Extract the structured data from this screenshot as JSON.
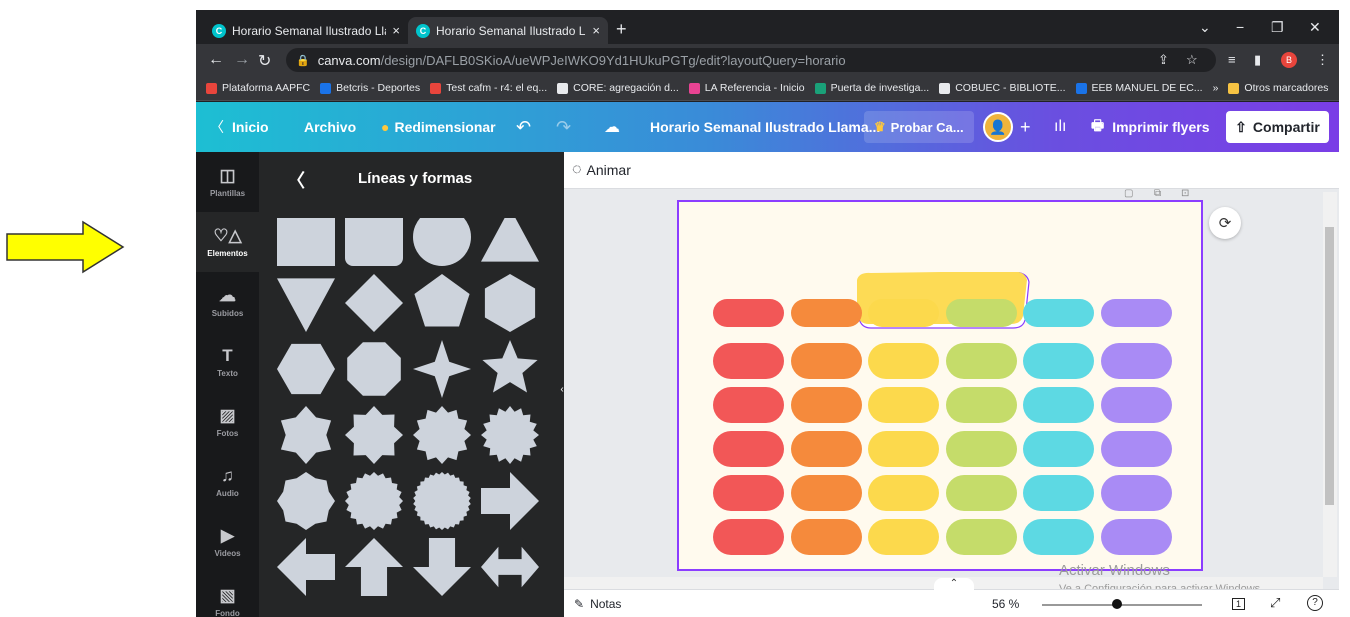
{
  "colors": {
    "arrow_fill": "#ffff00",
    "canva_accent": "#8b3dff",
    "shape_fill": "#cdd3dc"
  },
  "browser": {
    "tabs": [
      {
        "label": "Horario Semanal Ilustrado Llama",
        "close": "×"
      },
      {
        "label": "Horario Semanal Ilustrado Llama",
        "close": "×"
      }
    ],
    "new_tab": "+",
    "url_host": "canva.com",
    "url_path": "/design/DAFLB0SKioA/ueWPJeIWKO9Yd1HUkuPGTg/edit?layoutQuery=horario",
    "profile_initial": "B",
    "bookmarks": [
      {
        "label": "Plataforma AAPFC",
        "color": "#e8453c"
      },
      {
        "label": "Betcris - Deportes",
        "color": "#1a73e8"
      },
      {
        "label": "Test cafm - r4: el eq...",
        "color": "#e8453c"
      },
      {
        "label": "CORE: agregación d...",
        "color": "#e8eaed"
      },
      {
        "label": "LA Referencia - Inicio",
        "color": "#e84393"
      },
      {
        "label": "Puerta de investiga...",
        "color": "#1aa179"
      },
      {
        "label": "COBUEC - BIBLIOTE...",
        "color": "#e8eaed"
      },
      {
        "label": "EEB MANUEL DE EC...",
        "color": "#1a73e8"
      }
    ],
    "bookmarks_more": "»",
    "other_bookmarks": "Otros marcadores"
  },
  "canva_header": {
    "home": "Inicio",
    "file": "Archivo",
    "resize": "Redimensionar",
    "doc_title": "Horario Semanal Ilustrado Llama...",
    "try_pro": "Probar Ca...",
    "print": "Imprimir flyers",
    "share": "Compartir"
  },
  "rail": [
    {
      "label": "Plantillas",
      "icon": "template-icon",
      "glyph": "◫"
    },
    {
      "label": "Elementos",
      "icon": "elements-icon",
      "glyph": "♡△"
    },
    {
      "label": "Subidos",
      "icon": "upload-icon",
      "glyph": "☁"
    },
    {
      "label": "Texto",
      "icon": "text-icon",
      "glyph": "T"
    },
    {
      "label": "Fotos",
      "icon": "photo-icon",
      "glyph": "▨"
    },
    {
      "label": "Audio",
      "icon": "audio-icon",
      "glyph": "♫"
    },
    {
      "label": "Videos",
      "icon": "video-icon",
      "glyph": "▶"
    },
    {
      "label": "Fondo",
      "icon": "background-icon",
      "glyph": "▧"
    }
  ],
  "panel": {
    "title": "Líneas y formas"
  },
  "editor": {
    "animate": "Animar",
    "notes": "Notas",
    "zoom": "56 %",
    "page_number": "1",
    "watermark_title": "Activar Windows",
    "watermark_sub": "Ve a Configuración para activar Windows."
  },
  "schedule": {
    "column_colors": [
      "#f25757",
      "#f58a3c",
      "#fcd94c",
      "#c5dc6a",
      "#5dd9e3",
      "#a98bf5"
    ],
    "title_color": "#fddb55"
  }
}
